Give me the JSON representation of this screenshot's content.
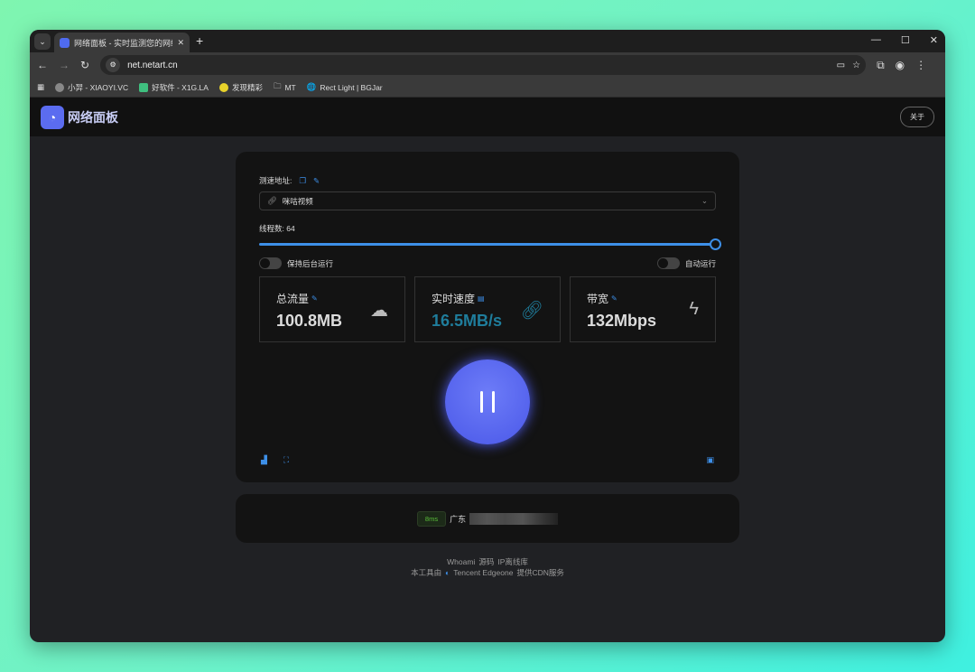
{
  "browser": {
    "tab_title": "网络面板 - 实时监测您的网络状",
    "url": "net.netart.cn",
    "bookmarks": [
      "小羿 - XIAOYI.VC",
      "好软件 - X1G.LA",
      "发现精彩",
      "MT",
      "Rect Light | BGJar"
    ]
  },
  "app": {
    "title": "网络面板",
    "about": "关于"
  },
  "test": {
    "url_label": "测速地址:",
    "selected": "咪咕视频",
    "threads_label": "线程数: 64",
    "threads": 64,
    "threads_max": 64,
    "toggle_bg": "保持后台运行",
    "toggle_auto": "自动运行"
  },
  "stats": [
    {
      "label": "总流量",
      "value": "100.8MB",
      "icon": "cloud-icon"
    },
    {
      "label": "实时速度",
      "value": "16.5MB/s",
      "icon": "link-icon"
    },
    {
      "label": "带宽",
      "value": "132Mbps",
      "icon": "lightning-icon"
    }
  ],
  "ping": {
    "latency": "8ms",
    "region": "广东"
  },
  "footer": {
    "links": [
      "Whoami",
      "源码",
      "IP离线库"
    ],
    "cdn_prefix": "本工具由",
    "cdn_name": "Tencent Edgeone",
    "cdn_suffix": "提供CDN服务"
  },
  "colors": {
    "accent": "#3d8fe8",
    "speed": "#1f7d9c",
    "play": "#5765f0"
  }
}
